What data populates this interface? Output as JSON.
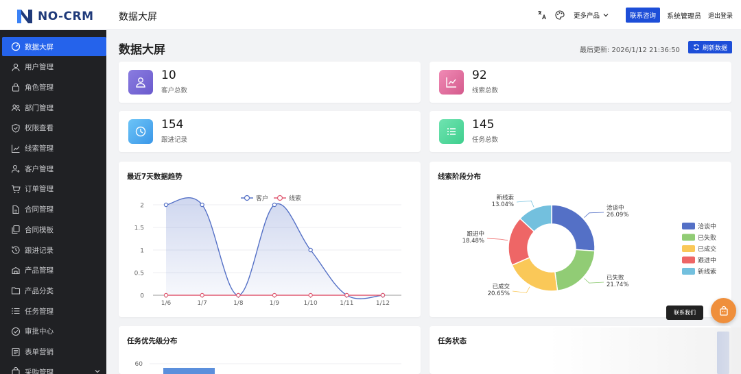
{
  "brand": {
    "name": "NO-CRM"
  },
  "header": {
    "title": "数据大屏",
    "more_products": "更多产品",
    "contact": "联系咨询",
    "admin": "系统管理员",
    "logout": "退出登录"
  },
  "sidebar": {
    "items": [
      {
        "label": "数据大屏",
        "icon": "dashboard-icon",
        "active": true
      },
      {
        "label": "用户管理",
        "icon": "user-icon"
      },
      {
        "label": "角色管理",
        "icon": "lock-icon"
      },
      {
        "label": "部门管理",
        "icon": "team-icon"
      },
      {
        "label": "权限查看",
        "icon": "shield-icon"
      },
      {
        "label": "线索管理",
        "icon": "chart-line-icon"
      },
      {
        "label": "客户管理",
        "icon": "user-add-icon"
      },
      {
        "label": "订单管理",
        "icon": "cart-icon"
      },
      {
        "label": "合同管理",
        "icon": "document-icon"
      },
      {
        "label": "合同模板",
        "icon": "copy-icon"
      },
      {
        "label": "跟进记录",
        "icon": "history-icon"
      },
      {
        "label": "产品管理",
        "icon": "product-icon"
      },
      {
        "label": "产品分类",
        "icon": "folder-icon"
      },
      {
        "label": "任务管理",
        "icon": "list-icon"
      },
      {
        "label": "审批中心",
        "icon": "check-circle-icon"
      },
      {
        "label": "表单营销",
        "icon": "form-icon"
      },
      {
        "label": "采购管理",
        "icon": "purchase-icon"
      }
    ]
  },
  "page": {
    "title": "数据大屏",
    "last_update": "最后更新: 2026/1/12 21:36:50",
    "refresh": "刷新数据"
  },
  "stats": [
    {
      "value": "10",
      "label": "客户总数",
      "icon": "user-icon",
      "color": "#7c6fd6"
    },
    {
      "value": "92",
      "label": "线索总数",
      "icon": "chart-line-icon",
      "color": "#e06a9a"
    },
    {
      "value": "154",
      "label": "跟进记录",
      "icon": "clock-icon",
      "color": "#4aa8ef"
    },
    {
      "value": "145",
      "label": "任务总数",
      "icon": "list-icon",
      "color": "#4cd69b"
    }
  ],
  "panels": {
    "trend": "最近7天数据趋势",
    "stage": "线索阶段分布",
    "priority": "任务优先级分布",
    "status": "任务状态"
  },
  "float_tooltip": "联系我们",
  "chart_data": [
    {
      "type": "line",
      "x": [
        "1/6",
        "1/7",
        "1/8",
        "1/9",
        "1/10",
        "1/11",
        "1/12"
      ],
      "series": [
        {
          "name": "客户",
          "values": [
            2,
            2,
            0,
            2,
            1,
            0,
            0
          ],
          "color": "#5470c6"
        },
        {
          "name": "线索",
          "values": [
            0,
            0,
            0,
            0,
            0,
            0,
            0
          ],
          "color": "#e05a72"
        }
      ],
      "yticks": [
        "2",
        "1.5",
        "1",
        "0.5",
        "0"
      ],
      "ylim": [
        0,
        2
      ],
      "legend": "top"
    },
    {
      "type": "pie",
      "slices": [
        {
          "name": "洽谈中",
          "value": 26.09,
          "label": "26.09%",
          "color": "#5470c6"
        },
        {
          "name": "已失败",
          "value": 21.74,
          "label": "21.74%",
          "color": "#91cc75"
        },
        {
          "name": "已成交",
          "value": 20.65,
          "label": "20.65%",
          "color": "#fac858"
        },
        {
          "name": "跟进中",
          "value": 18.48,
          "label": "18.48%",
          "color": "#ee6666"
        },
        {
          "name": "新线索",
          "value": 13.04,
          "label": "13.04%",
          "color": "#73c0de"
        }
      ],
      "legend": "right"
    },
    {
      "type": "bar",
      "yticks": [
        "60"
      ]
    }
  ]
}
